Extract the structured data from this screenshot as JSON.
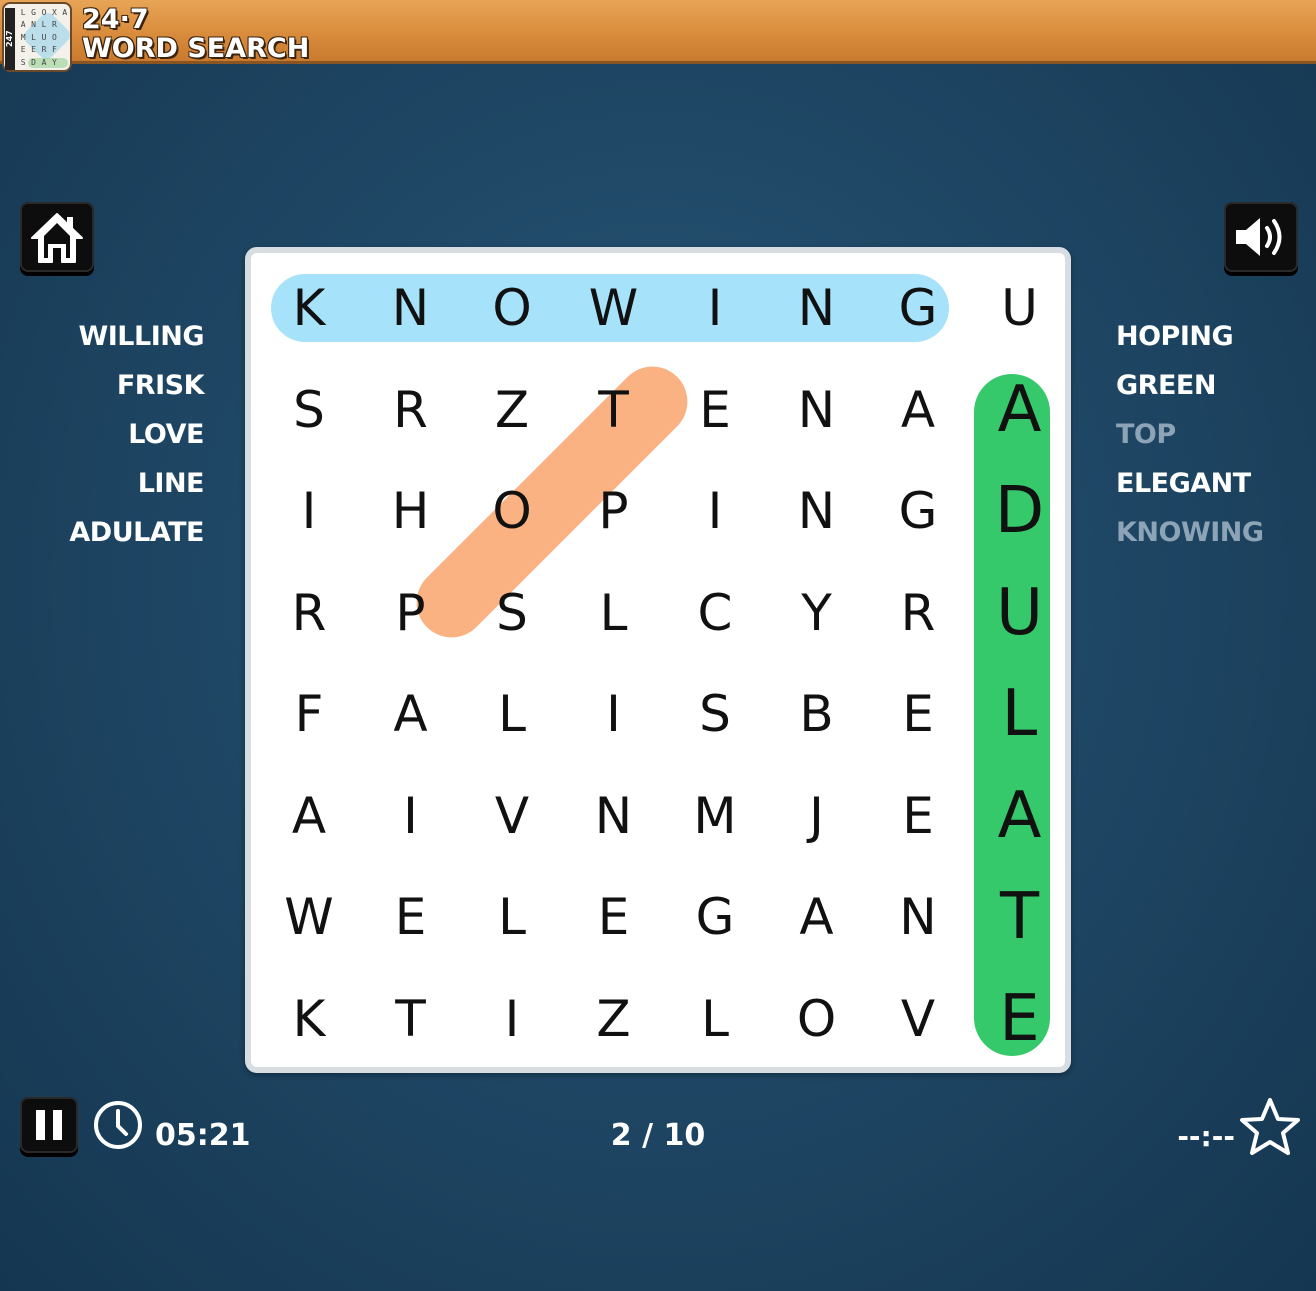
{
  "header": {
    "brand_line1": "24·7",
    "brand_line2": "WORD SEARCH",
    "logo_side_text": "247",
    "logo_letters": [
      "L",
      "G",
      "O",
      "X",
      "A",
      "A",
      "N",
      "L",
      "R",
      "",
      "M",
      "L",
      "U",
      "O",
      "",
      "E",
      "E",
      "R",
      "F",
      "",
      "S",
      "D",
      "A",
      "Y",
      ""
    ]
  },
  "icons": {
    "home": "home-icon",
    "sound": "speaker-icon",
    "pause": "pause-icon",
    "timer": "clock-icon",
    "best": "star-icon"
  },
  "grid": [
    [
      "K",
      "N",
      "O",
      "W",
      "I",
      "N",
      "G",
      "U"
    ],
    [
      "S",
      "R",
      "Z",
      "T",
      "E",
      "N",
      "A",
      "A"
    ],
    [
      "I",
      "H",
      "O",
      "P",
      "I",
      "N",
      "G",
      "D"
    ],
    [
      "R",
      "P",
      "S",
      "L",
      "C",
      "Y",
      "R",
      "U"
    ],
    [
      "F",
      "A",
      "L",
      "I",
      "S",
      "B",
      "E",
      "L"
    ],
    [
      "A",
      "I",
      "V",
      "N",
      "M",
      "J",
      "E",
      "A"
    ],
    [
      "W",
      "E",
      "L",
      "E",
      "G",
      "A",
      "N",
      "T"
    ],
    [
      "K",
      "T",
      "I",
      "Z",
      "L",
      "O",
      "V",
      "E"
    ]
  ],
  "highlights": [
    {
      "word": "KNOWING",
      "color": "#a6e3fb"
    },
    {
      "word": "TOP",
      "color": "#fbb283"
    },
    {
      "word": "ADULATE",
      "color": "#36c96c"
    }
  ],
  "words_left": [
    {
      "text": "WILLING",
      "found": false
    },
    {
      "text": "FRISK",
      "found": false
    },
    {
      "text": "LOVE",
      "found": false
    },
    {
      "text": "LINE",
      "found": false
    },
    {
      "text": "ADULATE",
      "found": false
    }
  ],
  "words_right": [
    {
      "text": "HOPING",
      "found": false
    },
    {
      "text": "GREEN",
      "found": false
    },
    {
      "text": "TOP",
      "found": true
    },
    {
      "text": "ELEGANT",
      "found": false
    },
    {
      "text": "KNOWING",
      "found": true
    }
  ],
  "footer": {
    "timer": "05:21",
    "progress": "2 / 10",
    "best_time": "--:--"
  },
  "colors": {
    "found_word": "#8da3b6",
    "background": "#1f4866"
  }
}
